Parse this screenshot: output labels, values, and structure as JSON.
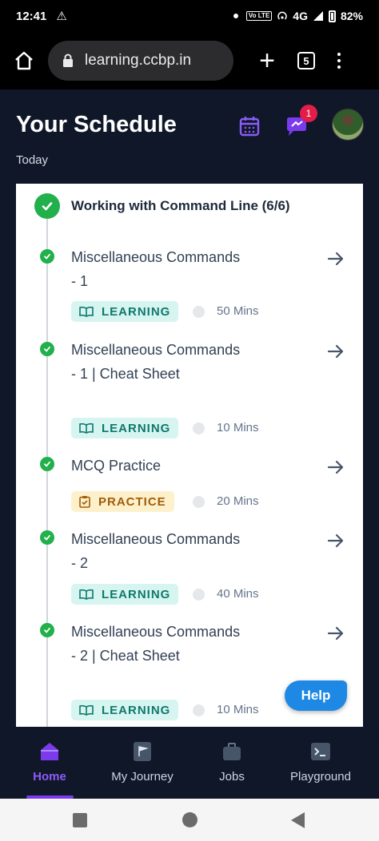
{
  "status_bar": {
    "time": "12:41",
    "network": "4G",
    "volte_label": "Vo LTE",
    "battery": "82%"
  },
  "browser": {
    "url": "learning.ccbp.in",
    "tab_count": "5"
  },
  "header": {
    "title": "Your Schedule",
    "subtitle": "Today",
    "notification_count": "1"
  },
  "module": {
    "title": "Working with Command Line (6/6)",
    "items": [
      {
        "title": "Miscellaneous Commands - 1",
        "type": "LEARNING",
        "duration": "50 Mins"
      },
      {
        "title": "Miscellaneous Commands - 1 | Cheat Sheet",
        "type": "LEARNING",
        "duration": "10 Mins"
      },
      {
        "title": "MCQ Practice",
        "type": "PRACTICE",
        "duration": "20 Mins"
      },
      {
        "title": "Miscellaneous Commands - 2",
        "type": "LEARNING",
        "duration": "40 Mins"
      },
      {
        "title": "Miscellaneous Commands - 2 | Cheat Sheet",
        "type": "LEARNING",
        "duration": "10 Mins"
      }
    ]
  },
  "help_label": "Help",
  "nav": {
    "items": [
      {
        "label": "Home",
        "icon": "home-icon",
        "active": true
      },
      {
        "label": "My Journey",
        "icon": "journey-flag-icon",
        "active": false
      },
      {
        "label": "Jobs",
        "icon": "briefcase-icon",
        "active": false
      },
      {
        "label": "Playground",
        "icon": "terminal-icon",
        "active": false
      }
    ]
  },
  "colors": {
    "header_bg": "#0f1729",
    "accent_purple": "#7c3aed",
    "success_green": "#21b04b",
    "learning_bg": "#d6f5f1",
    "learning_text": "#10786b",
    "practice_bg": "#fdf1cc",
    "practice_text": "#a15c07",
    "help_blue": "#1e88e5",
    "badge_red": "#e11d48"
  }
}
